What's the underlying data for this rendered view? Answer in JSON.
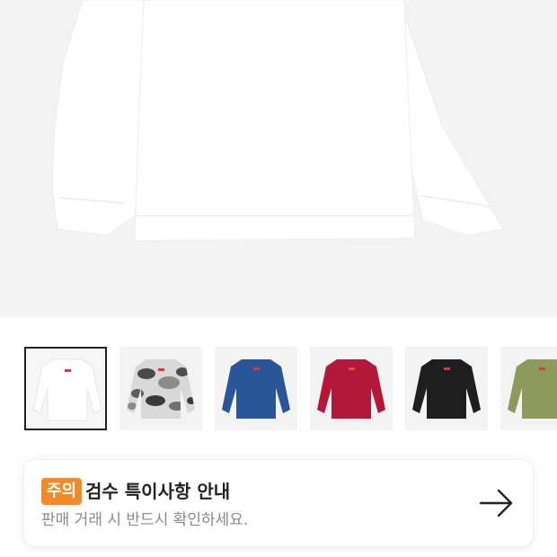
{
  "product_gallery": {
    "main_image_color": "white",
    "thumbnails": [
      {
        "color_name": "White",
        "body_color": "#ffffff",
        "selected": true
      },
      {
        "color_name": "Camo",
        "body_color": "#cfcfcf",
        "selected": false
      },
      {
        "color_name": "Royal",
        "body_color": "#2a5599",
        "selected": false
      },
      {
        "color_name": "Red",
        "body_color": "#b3173a",
        "selected": false
      },
      {
        "color_name": "Black",
        "body_color": "#1e1e1e",
        "selected": false
      },
      {
        "color_name": "Olive",
        "body_color": "#8e9a5c",
        "selected": false
      }
    ]
  },
  "inspection_notice": {
    "badge_label": "주의",
    "title": "검수 특이사항 안내",
    "subtitle": "판매 거래 시 반드시 확인하세요.",
    "arrow_icon": "arrow-right-icon",
    "badge_color": "#f28a2a"
  }
}
